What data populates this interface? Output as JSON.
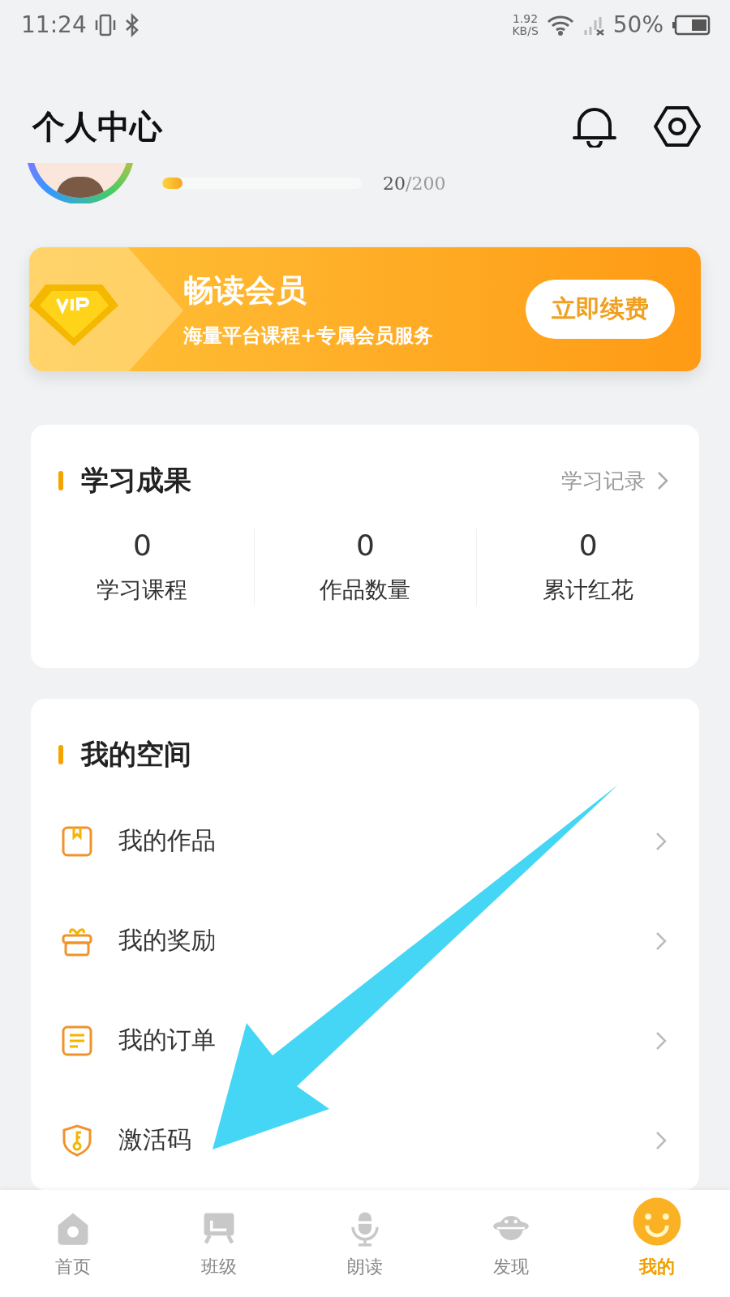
{
  "status_bar": {
    "time": "11:24",
    "speed": "1.92",
    "speed_unit": "KB/S",
    "battery": "50%"
  },
  "header": {
    "title": "个人中心"
  },
  "profile": {
    "progress": {
      "level": 0.1
    },
    "current": "20",
    "total": "/200"
  },
  "vip": {
    "title": "畅读会员",
    "subtitle": "海量平台课程+专属会员服务",
    "button": "立即续费"
  },
  "achievements": {
    "title": "学习成果",
    "link": "学习记录",
    "stats": [
      {
        "value": "0",
        "label": "学习课程"
      },
      {
        "value": "0",
        "label": "作品数量"
      },
      {
        "value": "0",
        "label": "累计红花"
      }
    ]
  },
  "space": {
    "title": "我的空间",
    "items": [
      {
        "label": "我的作品",
        "kind": "bookmark"
      },
      {
        "label": "我的奖励",
        "kind": "gift"
      },
      {
        "label": "我的订单",
        "kind": "list"
      },
      {
        "label": "激活码",
        "kind": "key"
      }
    ]
  },
  "nav": {
    "items": [
      {
        "label": "首页",
        "kind": "home",
        "selected": false
      },
      {
        "label": "班级",
        "kind": "class",
        "selected": false
      },
      {
        "label": "朗读",
        "kind": "mic",
        "selected": false
      },
      {
        "label": "发现",
        "kind": "planet",
        "selected": false
      },
      {
        "label": "我的",
        "kind": "smile",
        "selected": true
      }
    ]
  }
}
